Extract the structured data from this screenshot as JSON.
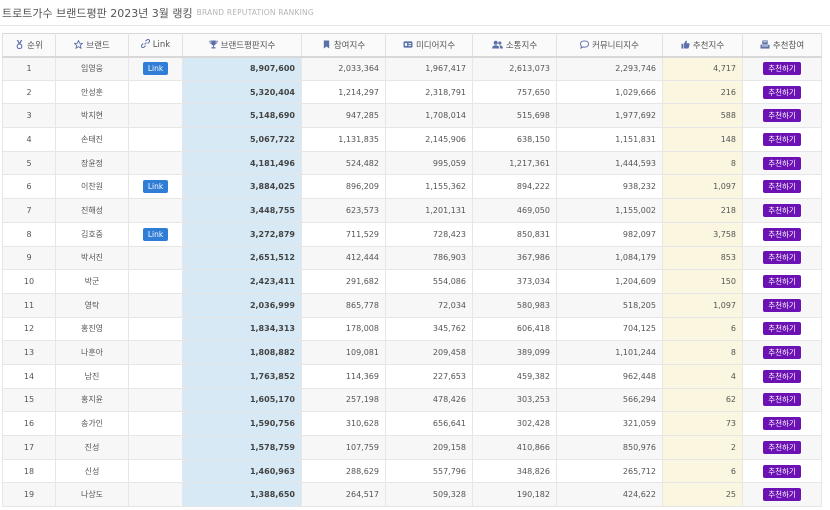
{
  "page": {
    "title": "트로트가수 브랜드평판 2023년 3월 랭킹",
    "subtitle": "BRAND REPUTATION RANKING"
  },
  "colors": {
    "brand_column_bg": "#d6e9f4",
    "recommend_column_bg": "#fbf6df",
    "link_button": "#2f7dd7",
    "recommend_button": "#6c12b5",
    "header_icon": "#5b6fa8"
  },
  "table": {
    "headers": [
      {
        "label": "순위",
        "icon": "medal-icon"
      },
      {
        "label": "브랜드",
        "icon": "star-icon"
      },
      {
        "label": "Link",
        "icon": "link-icon"
      },
      {
        "label": "브랜드평판지수",
        "icon": "trophy-icon"
      },
      {
        "label": "참여지수",
        "icon": "bookmark-icon"
      },
      {
        "label": "미디어지수",
        "icon": "media-icon"
      },
      {
        "label": "소통지수",
        "icon": "users-icon"
      },
      {
        "label": "커뮤니티지수",
        "icon": "comment-icon"
      },
      {
        "label": "추천지수",
        "icon": "thumbs-up-icon"
      },
      {
        "label": "추천참여",
        "icon": "vote-icon"
      }
    ],
    "link_label": "Link",
    "recommend_label": "추천하기",
    "rows": [
      {
        "rank": "1",
        "brand": "임영웅",
        "has_link": true,
        "brand_index": "8,907,600",
        "participation": "2,033,364",
        "media": "1,967,417",
        "communication": "2,613,073",
        "community": "2,293,746",
        "recommend": "4,717"
      },
      {
        "rank": "2",
        "brand": "안성훈",
        "has_link": false,
        "brand_index": "5,320,404",
        "participation": "1,214,297",
        "media": "2,318,791",
        "communication": "757,650",
        "community": "1,029,666",
        "recommend": "216"
      },
      {
        "rank": "3",
        "brand": "박지현",
        "has_link": false,
        "brand_index": "5,148,690",
        "participation": "947,285",
        "media": "1,708,014",
        "communication": "515,698",
        "community": "1,977,692",
        "recommend": "588"
      },
      {
        "rank": "4",
        "brand": "손태진",
        "has_link": false,
        "brand_index": "5,067,722",
        "participation": "1,131,835",
        "media": "2,145,906",
        "communication": "638,150",
        "community": "1,151,831",
        "recommend": "148"
      },
      {
        "rank": "5",
        "brand": "장윤정",
        "has_link": false,
        "brand_index": "4,181,496",
        "participation": "524,482",
        "media": "995,059",
        "communication": "1,217,361",
        "community": "1,444,593",
        "recommend": "8"
      },
      {
        "rank": "6",
        "brand": "이찬원",
        "has_link": true,
        "brand_index": "3,884,025",
        "participation": "896,209",
        "media": "1,155,362",
        "communication": "894,222",
        "community": "938,232",
        "recommend": "1,097"
      },
      {
        "rank": "7",
        "brand": "진해성",
        "has_link": false,
        "brand_index": "3,448,755",
        "participation": "623,573",
        "media": "1,201,131",
        "communication": "469,050",
        "community": "1,155,002",
        "recommend": "218"
      },
      {
        "rank": "8",
        "brand": "김호중",
        "has_link": true,
        "brand_index": "3,272,879",
        "participation": "711,529",
        "media": "728,423",
        "communication": "850,831",
        "community": "982,097",
        "recommend": "3,758"
      },
      {
        "rank": "9",
        "brand": "박서진",
        "has_link": false,
        "brand_index": "2,651,512",
        "participation": "412,444",
        "media": "786,903",
        "communication": "367,986",
        "community": "1,084,179",
        "recommend": "853"
      },
      {
        "rank": "10",
        "brand": "박군",
        "has_link": false,
        "brand_index": "2,423,411",
        "participation": "291,682",
        "media": "554,086",
        "communication": "373,034",
        "community": "1,204,609",
        "recommend": "150"
      },
      {
        "rank": "11",
        "brand": "영탁",
        "has_link": false,
        "brand_index": "2,036,999",
        "participation": "865,778",
        "media": "72,034",
        "communication": "580,983",
        "community": "518,205",
        "recommend": "1,097"
      },
      {
        "rank": "12",
        "brand": "홍진영",
        "has_link": false,
        "brand_index": "1,834,313",
        "participation": "178,008",
        "media": "345,762",
        "communication": "606,418",
        "community": "704,125",
        "recommend": "6"
      },
      {
        "rank": "13",
        "brand": "나훈아",
        "has_link": false,
        "brand_index": "1,808,882",
        "participation": "109,081",
        "media": "209,458",
        "communication": "389,099",
        "community": "1,101,244",
        "recommend": "8"
      },
      {
        "rank": "14",
        "brand": "남진",
        "has_link": false,
        "brand_index": "1,763,852",
        "participation": "114,369",
        "media": "227,653",
        "communication": "459,382",
        "community": "962,448",
        "recommend": "4"
      },
      {
        "rank": "15",
        "brand": "홍지윤",
        "has_link": false,
        "brand_index": "1,605,170",
        "participation": "257,198",
        "media": "478,426",
        "communication": "303,253",
        "community": "566,294",
        "recommend": "62"
      },
      {
        "rank": "16",
        "brand": "송가인",
        "has_link": false,
        "brand_index": "1,590,756",
        "participation": "310,628",
        "media": "656,641",
        "communication": "302,428",
        "community": "321,059",
        "recommend": "73"
      },
      {
        "rank": "17",
        "brand": "진성",
        "has_link": false,
        "brand_index": "1,578,759",
        "participation": "107,759",
        "media": "209,158",
        "communication": "410,866",
        "community": "850,976",
        "recommend": "2"
      },
      {
        "rank": "18",
        "brand": "신성",
        "has_link": false,
        "brand_index": "1,460,963",
        "participation": "288,629",
        "media": "557,796",
        "communication": "348,826",
        "community": "265,712",
        "recommend": "6"
      },
      {
        "rank": "19",
        "brand": "나상도",
        "has_link": false,
        "brand_index": "1,388,650",
        "participation": "264,517",
        "media": "509,328",
        "communication": "190,182",
        "community": "424,622",
        "recommend": "25"
      }
    ]
  }
}
